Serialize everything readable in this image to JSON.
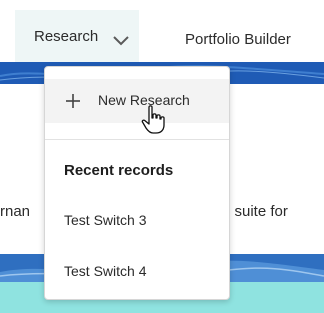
{
  "nav": {
    "research_label": "Research",
    "portfolio_label": "Portfolio Builder"
  },
  "page": {
    "text_fragment_left": "rnan",
    "text_fragment_right": "e suite for"
  },
  "dropdown": {
    "new_item_label": "New Research",
    "recent_header": "Recent records",
    "recent_items": [
      {
        "label": "Test Switch 3"
      },
      {
        "label": "Test Switch 4"
      }
    ]
  },
  "colors": {
    "accent_blue": "#1f5bb5",
    "teal": "#8fe3e0",
    "active_tab_bg": "#eef6f6"
  }
}
